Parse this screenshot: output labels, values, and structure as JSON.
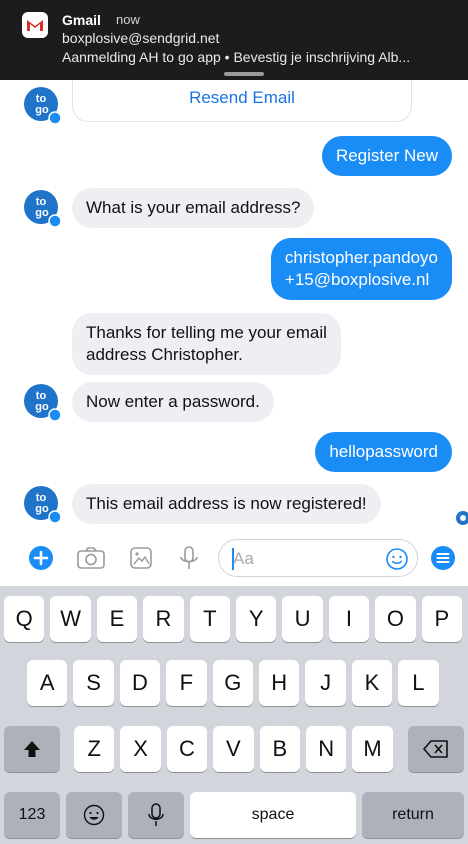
{
  "notification": {
    "app": "Gmail",
    "time": "now",
    "sender": "boxplosive@sendgrid.net",
    "preview": "Aanmelding AH to go app  •  Bevestig je inschrijving Alb..."
  },
  "chat": {
    "resend_button": "Resend Email",
    "messages": [
      {
        "from": "me",
        "text": "Register New"
      },
      {
        "from": "bot",
        "text": "What is your email address?"
      },
      {
        "from": "me",
        "lines": [
          "christopher.pandoyo",
          "+15@boxplosive.nl"
        ]
      },
      {
        "from": "bot",
        "lines": [
          "Thanks for telling me your email",
          "address Christopher."
        ]
      },
      {
        "from": "bot",
        "text": "Now enter a password."
      },
      {
        "from": "me",
        "text": "hellopassword"
      },
      {
        "from": "bot",
        "text": "This email address is now registered!"
      }
    ]
  },
  "composer": {
    "placeholder": "Aa"
  },
  "keyboard": {
    "row1": [
      "Q",
      "W",
      "E",
      "R",
      "T",
      "Y",
      "U",
      "I",
      "O",
      "P"
    ],
    "row2": [
      "A",
      "S",
      "D",
      "F",
      "G",
      "H",
      "J",
      "K",
      "L"
    ],
    "row3": [
      "Z",
      "X",
      "C",
      "V",
      "B",
      "N",
      "M"
    ],
    "numbers_key": "123",
    "space_key": "space",
    "return_key": "return"
  },
  "colors": {
    "accent": "#1a8cf5",
    "bot_bubble": "#efeef3",
    "keyboard_bg": "#d2d5db"
  }
}
